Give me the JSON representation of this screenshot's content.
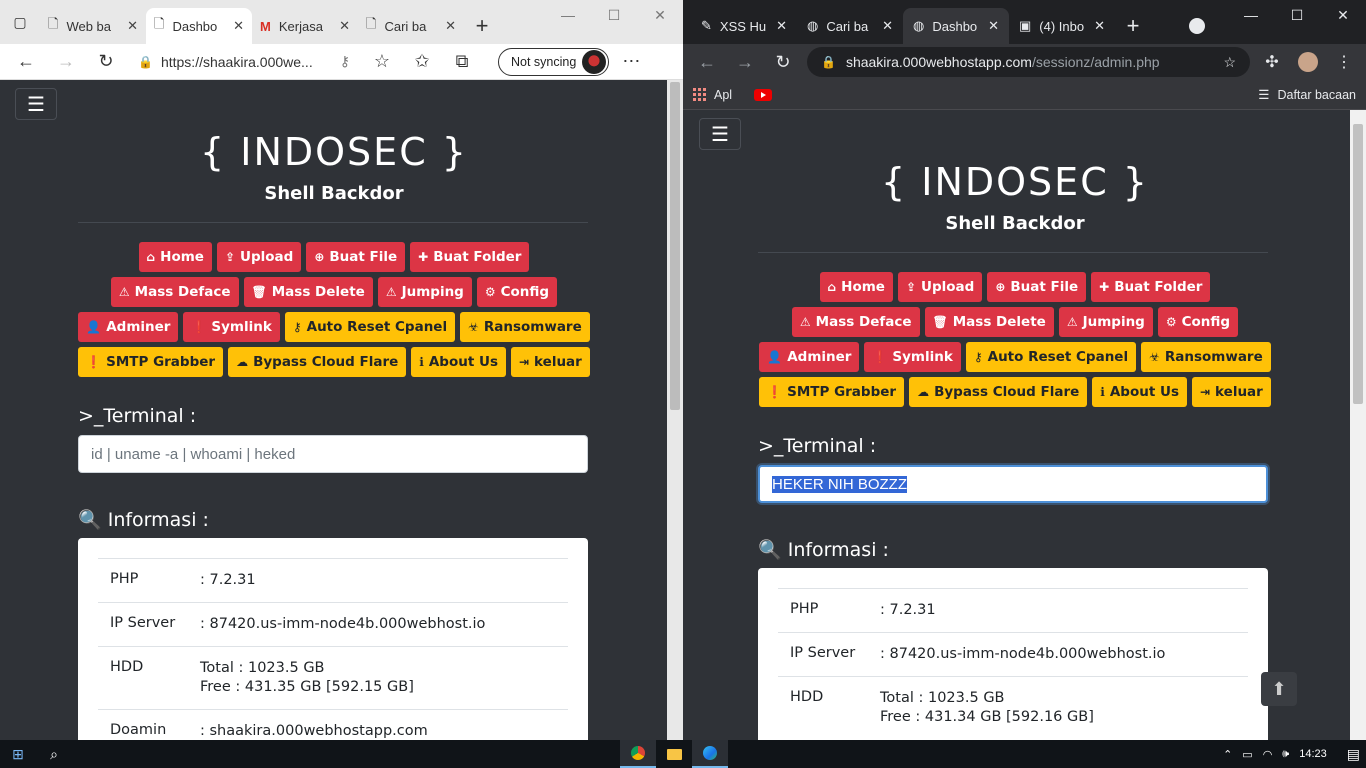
{
  "edge": {
    "tabs": [
      {
        "label": "Web ba",
        "active": false
      },
      {
        "label": "Dashbo",
        "active": true
      },
      {
        "label": "Kerjasa",
        "active": false
      },
      {
        "label": "Cari ba",
        "active": false
      }
    ],
    "url": "https://shaakira.000we...",
    "sync_label": "Not syncing",
    "page": {
      "terminal_placeholder": "id | uname -a | whoami | heked",
      "hdd_free": "Free : 431.35 GB [592.15 GB]"
    }
  },
  "chrome": {
    "tabs": [
      {
        "label": "XSS Hu",
        "active": false
      },
      {
        "label": "Cari ba",
        "active": false
      },
      {
        "label": "Dashbo",
        "active": true
      },
      {
        "label": "(4) Inbo",
        "active": false
      }
    ],
    "url_host": "shaakira.000webhostapp.com",
    "url_path": "/sessionz/admin.php",
    "bookmarks": {
      "apps": "Apl",
      "reading_list": "Daftar bacaan"
    },
    "page": {
      "terminal_value": "HEKER NIH BOZZZ",
      "hdd_free": "Free : 431.34 GB [592.16 GB]"
    }
  },
  "site": {
    "logo": "{ INDOSEC }",
    "subtitle": "Shell Backdor",
    "menu": {
      "home": "Home",
      "upload": "Upload",
      "buat_file": "Buat File",
      "buat_folder": "Buat Folder",
      "mass_deface": "Mass Deface",
      "mass_delete": "Mass Delete",
      "jumping": "Jumping",
      "config": "Config",
      "adminer": "Adminer",
      "symlink": "Symlink",
      "auto_reset_cpanel": "Auto Reset Cpanel",
      "ransomware": "Ransomware",
      "smtp_grabber": "SMTP Grabber",
      "bypass_cloud_flare": "Bypass Cloud Flare",
      "about_us": "About Us",
      "keluar": "keluar"
    },
    "terminal_title": ">_Terminal :",
    "info_title": "Informasi :",
    "info": {
      "php_key": "PHP",
      "php_val": ": 7.2.31",
      "ip_key": "IP Server",
      "ip_val": ": 87420.us-imm-node4b.000webhost.io",
      "hdd_key": "HDD",
      "hdd_total": "Total : 1023.5 GB",
      "domain_key": "Doamin",
      "domain_val": ": shaakira.000webhostapp.com"
    }
  },
  "taskbar": {
    "time": "14:23"
  },
  "colors": {
    "red_button": "#dc3545",
    "yellow_button": "#ffc107",
    "page_bg": "#2f3237"
  }
}
